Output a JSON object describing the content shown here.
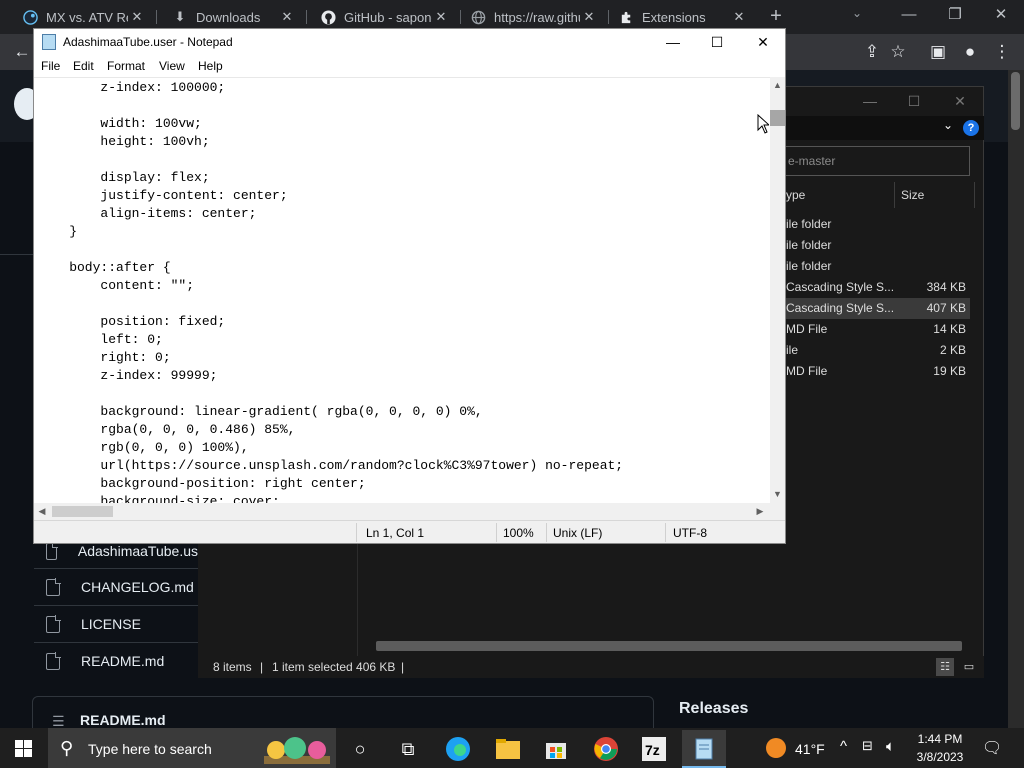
{
  "browser": {
    "tabs": [
      {
        "label": "MX vs. ATV Refle",
        "icon": "steam-icon"
      },
      {
        "label": "Downloads",
        "icon": "download-icon"
      },
      {
        "label": "GitHub - sapone",
        "icon": "github-icon"
      },
      {
        "label": "https://raw.githu",
        "icon": "globe-icon"
      },
      {
        "label": "Extensions",
        "icon": "puzzle-icon"
      }
    ]
  },
  "notepad": {
    "title": "AdashimaaTube.user - Notepad",
    "menu": [
      "File",
      "Edit",
      "Format",
      "View",
      "Help"
    ],
    "lines": [
      "        z-index: 100000;",
      "",
      "        width: 100vw;",
      "        height: 100vh;",
      "",
      "        display: flex;",
      "        justify-content: center;",
      "        align-items: center;",
      "    }",
      "",
      "    body::after {",
      "        content: \"\";",
      "",
      "        position: fixed;",
      "        left: 0;",
      "        right: 0;",
      "        z-index: 99999;",
      "",
      "        background: linear-gradient( rgba(0, 0, 0, 0) 0%,",
      "        rgba(0, 0, 0, 0.486) 85%,",
      "        rgb(0, 0, 0) 100%),",
      "        url(https://source.unsplash.com/random?clock%C3%97tower) no-repeat;",
      "        background-position: right center;",
      "        background-size: cover;"
    ],
    "status": {
      "position": "Ln 1, Col 1",
      "zoom": "100%",
      "line_ending": "Unix (LF)",
      "encoding": "UTF-8"
    }
  },
  "explorer": {
    "search_placeholder": "e-master",
    "col_type": "ype",
    "col_size": "Size",
    "rows": [
      {
        "type": "ile folder",
        "size": "",
        "selected": false
      },
      {
        "type": "ile folder",
        "size": "",
        "selected": false
      },
      {
        "type": "ile folder",
        "size": "",
        "selected": false
      },
      {
        "type": "Cascading Style S...",
        "size": "384 KB",
        "selected": false
      },
      {
        "type": "Cascading Style S...",
        "size": "407 KB",
        "selected": true
      },
      {
        "type": "MD File",
        "size": "14 KB",
        "selected": false
      },
      {
        "type": "ile",
        "size": "2 KB",
        "selected": false
      },
      {
        "type": "MD File",
        "size": "19 KB",
        "selected": false
      }
    ],
    "status": {
      "items": "8 items",
      "selected": "1 item selected  406 KB"
    }
  },
  "github": {
    "files": [
      "AdashimaaTube.us",
      "CHANGELOG.md",
      "LICENSE",
      "README.md"
    ],
    "readme_header": "README.md",
    "releases": "Releases"
  },
  "taskbar": {
    "search_placeholder": "Type here to search",
    "temperature": "41°F",
    "time": "1:44 PM",
    "date": "3/8/2023"
  }
}
